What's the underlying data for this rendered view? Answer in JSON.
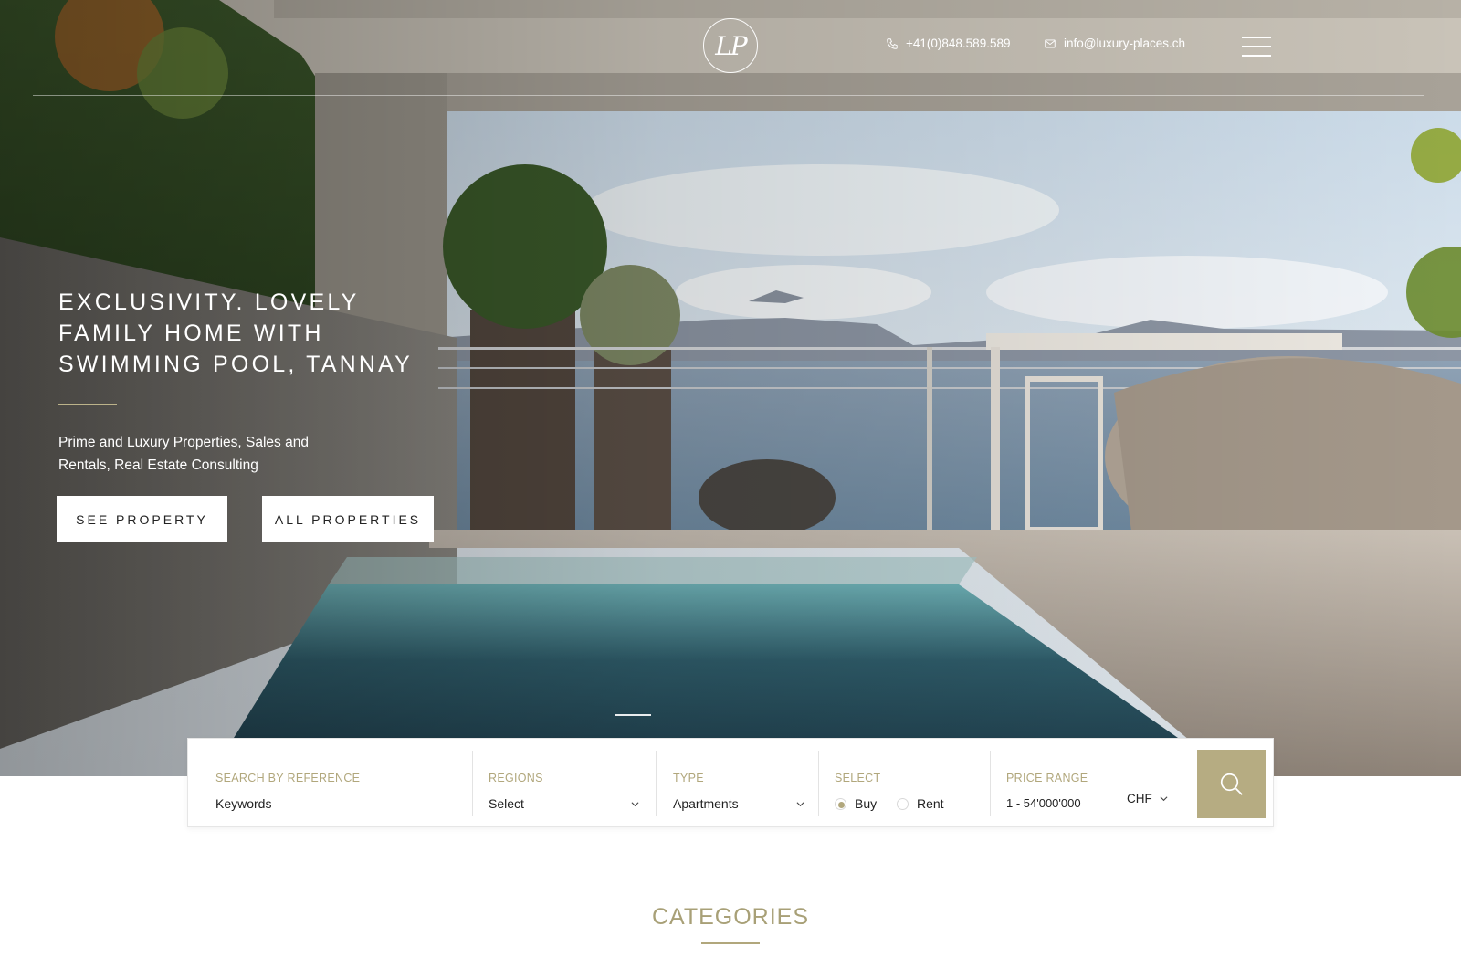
{
  "header": {
    "logo_text": "LP",
    "phone": "+41(0)848.589.589",
    "email": "info@luxury-places.ch"
  },
  "icons": {
    "phone": "phone-icon",
    "email": "envelope-icon",
    "menu": "hamburger-menu-icon",
    "search": "search-icon",
    "dropdown": "chevron-down-icon"
  },
  "hero": {
    "title": "EXCLUSIVITY. LOVELY FAMILY HOME WITH SWIMMING POOL, TANNAY",
    "subtitle": "Prime and Luxury Properties, Sales and Rentals, Real Estate Consulting",
    "buttons": {
      "see_property": "SEE PROPERTY",
      "all_properties": "ALL PROPERTIES"
    },
    "slides_count": 2,
    "active_slide": 1
  },
  "search": {
    "reference": {
      "label": "SEARCH BY REFERENCE",
      "placeholder": "Keywords"
    },
    "regions": {
      "label": "REGIONS",
      "value": "Select"
    },
    "type": {
      "label": "TYPE",
      "value": "Apartments"
    },
    "select": {
      "label": "SELECT",
      "options": [
        {
          "label": "Buy",
          "selected": true
        },
        {
          "label": "Rent",
          "selected": false
        }
      ]
    },
    "price": {
      "label": "PRICE RANGE",
      "value": "1 - 54'000'000",
      "currency": "CHF"
    }
  },
  "categories": {
    "title": "CATEGORIES"
  },
  "colors": {
    "accent_gold": "#b6ac82",
    "label_gold": "#b1a77c",
    "text_dark": "#222222",
    "white": "#ffffff"
  }
}
